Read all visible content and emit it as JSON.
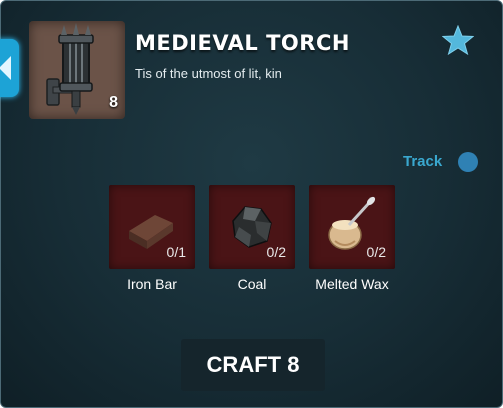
{
  "item": {
    "title": "MEDIEVAL TORCH",
    "description": "Tis of the utmost of lit, kin",
    "count": "8",
    "icon": "medieval-torch-icon"
  },
  "track": {
    "label": "Track",
    "enabled": false,
    "accent_color": "#3aa8cf"
  },
  "favorite": {
    "icon": "star-icon",
    "color": "#54b8dc"
  },
  "ingredients": [
    {
      "name": "Iron Bar",
      "count": "0/1",
      "icon": "iron-bar-icon"
    },
    {
      "name": "Coal",
      "count": "0/2",
      "icon": "coal-icon"
    },
    {
      "name": "Melted Wax",
      "count": "0/2",
      "icon": "melted-wax-icon"
    }
  ],
  "craft": {
    "label": "CRAFT 8"
  }
}
